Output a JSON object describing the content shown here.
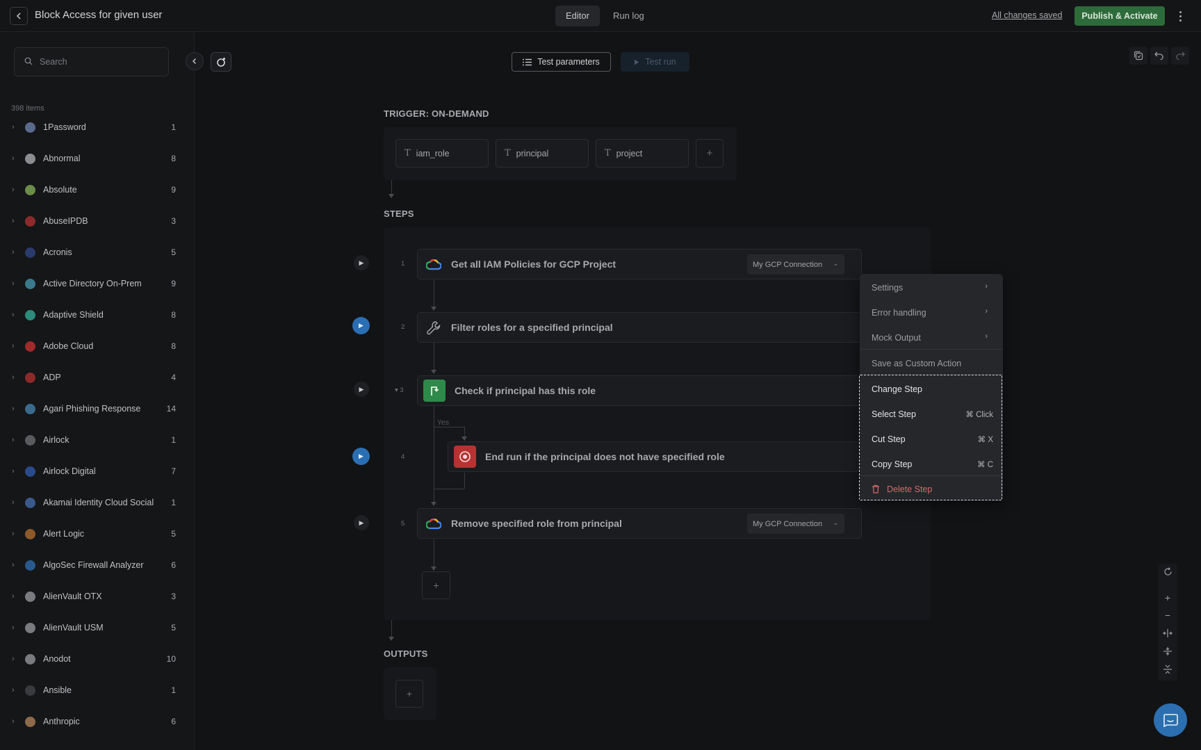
{
  "header": {
    "title": "Block Access for given user",
    "tabs": [
      {
        "label": "Editor",
        "active": true
      },
      {
        "label": "Run log",
        "active": false
      }
    ],
    "save_status": "All changes saved",
    "publish_label": "Publish & Activate"
  },
  "sidebar": {
    "search_placeholder": "Search",
    "items_count": "398 items",
    "items": [
      {
        "name": "1Password",
        "count": "1",
        "color": "#5b6a8c"
      },
      {
        "name": "Abnormal",
        "count": "8",
        "color": "#8c8d90"
      },
      {
        "name": "Absolute",
        "count": "9",
        "color": "#6b8c4a"
      },
      {
        "name": "AbuseIPDB",
        "count": "3",
        "color": "#8c2a2a"
      },
      {
        "name": "Acronis",
        "count": "5",
        "color": "#2a3a6b"
      },
      {
        "name": "Active Directory On-Prem",
        "count": "9",
        "color": "#3a7a8c"
      },
      {
        "name": "Adaptive Shield",
        "count": "8",
        "color": "#2a8c7a"
      },
      {
        "name": "Adobe Cloud",
        "count": "8",
        "color": "#a02a2a"
      },
      {
        "name": "ADP",
        "count": "4",
        "color": "#8c2a2a"
      },
      {
        "name": "Agari Phishing Response",
        "count": "14",
        "color": "#3a6b8c"
      },
      {
        "name": "Airlock",
        "count": "1",
        "color": "#5a5b5f"
      },
      {
        "name": "Airlock Digital",
        "count": "7",
        "color": "#2a4a8c"
      },
      {
        "name": "Akamai Identity Cloud Social",
        "count": "1",
        "color": "#3a5a8c"
      },
      {
        "name": "Alert Logic",
        "count": "5",
        "color": "#8c5a2a"
      },
      {
        "name": "AlgoSec Firewall Analyzer",
        "count": "6",
        "color": "#2a5a8c"
      },
      {
        "name": "AlienVault OTX",
        "count": "3",
        "color": "#7a7b7f"
      },
      {
        "name": "AlienVault USM",
        "count": "5",
        "color": "#7a7b7f"
      },
      {
        "name": "Anodot",
        "count": "10",
        "color": "#7a7b7f"
      },
      {
        "name": "Ansible",
        "count": "1",
        "color": "#3a3b3f"
      },
      {
        "name": "Anthropic",
        "count": "6",
        "color": "#8c6a4a"
      }
    ]
  },
  "toolbar": {
    "test_params_label": "Test parameters",
    "test_run_label": "Test run"
  },
  "trigger": {
    "label": "TRIGGER: ON-DEMAND",
    "params": [
      "iam_role",
      "principal",
      "project"
    ]
  },
  "steps": {
    "label": "STEPS",
    "items": [
      {
        "num": "1",
        "title": "Get all IAM Policies for GCP Project",
        "connection": "My GCP Connection"
      },
      {
        "num": "2",
        "title": "Filter roles for a specified principal"
      },
      {
        "num": "3",
        "title": "Check if principal has this role"
      },
      {
        "num": "4",
        "title": "End run if the principal does not have specified role"
      },
      {
        "num": "5",
        "title": "Remove specified role from principal",
        "connection": "My GCP Connection"
      }
    ],
    "yes_label": "Yes"
  },
  "outputs": {
    "label": "OUTPUTS"
  },
  "context_menu": {
    "settings": "Settings",
    "error_handling": "Error handling",
    "mock_output": "Mock Output",
    "save_custom": "Save as Custom Action",
    "change_step": "Change Step",
    "select_step": "Select Step",
    "select_shortcut": "⌘ Click",
    "cut_step": "Cut Step",
    "cut_shortcut": "⌘ X",
    "copy_step": "Copy Step",
    "copy_shortcut": "⌘ C",
    "delete_step": "Delete Step"
  },
  "colors": {
    "accent_green": "#2e6b3a",
    "accent_blue": "#2a6fb3",
    "danger": "#d76a6a"
  }
}
